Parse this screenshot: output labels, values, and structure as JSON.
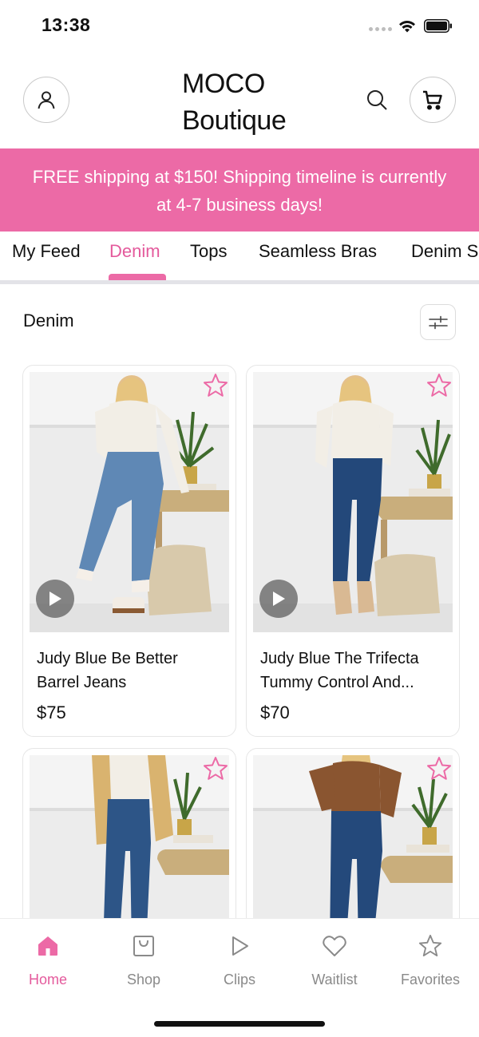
{
  "status_bar": {
    "time": "13:38"
  },
  "header": {
    "brand_line1": "MOCO",
    "brand_line2": "Boutique",
    "account_icon": "person-icon",
    "search_icon": "search-icon",
    "cart_icon": "cart-icon"
  },
  "banner": {
    "line1": "FREE shipping at $150! Shipping timeline is currently",
    "line2": "at 4-7 business days!"
  },
  "tabs": [
    {
      "label": "My Feed",
      "active": false
    },
    {
      "label": "Denim",
      "active": true
    },
    {
      "label": "Tops",
      "active": false
    },
    {
      "label": "Seamless Bras",
      "active": false
    },
    {
      "label": "Denim Sh",
      "active": false
    }
  ],
  "section": {
    "title": "Denim",
    "filter_icon": "sliders-icon"
  },
  "products": [
    {
      "name_line1": "Judy Blue Be Better",
      "name_line2": "Barrel Jeans",
      "price": "$75",
      "has_video": true
    },
    {
      "name_line1": "Judy Blue The Trifecta",
      "name_line2": "Tummy Control And...",
      "price": "$70",
      "has_video": true
    },
    {
      "name_line1": "",
      "name_line2": "",
      "price": "",
      "has_video": false
    },
    {
      "name_line1": "",
      "name_line2": "",
      "price": "",
      "has_video": false
    }
  ],
  "bottom_nav": [
    {
      "label": "Home",
      "icon": "home-icon",
      "active": true
    },
    {
      "label": "Shop",
      "icon": "shopping-bag-icon",
      "active": false
    },
    {
      "label": "Clips",
      "icon": "play-icon",
      "active": false
    },
    {
      "label": "Waitlist",
      "icon": "heart-icon",
      "active": false
    },
    {
      "label": "Favorites",
      "icon": "star-icon",
      "active": false
    }
  ],
  "colors": {
    "accent": "#ec6aa6",
    "accent_text": "#e45a9c",
    "inactive": "#8a8a8a"
  }
}
